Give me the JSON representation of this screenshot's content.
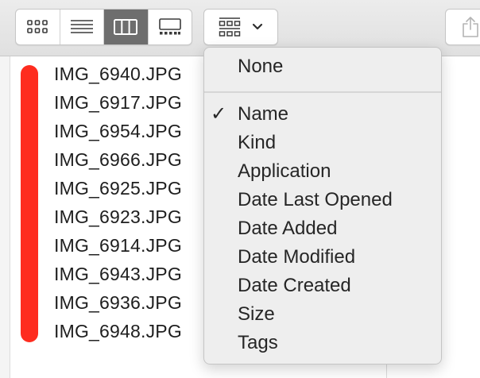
{
  "toolbar": {
    "view_buttons": [
      {
        "icon": "icon-view-icon",
        "active": false
      },
      {
        "icon": "list-view-icon",
        "active": false
      },
      {
        "icon": "column-view-icon",
        "active": true
      },
      {
        "icon": "gallery-view-icon",
        "active": false
      }
    ],
    "group_button": {
      "icon": "group-by-icon",
      "chevron": "chevron-down-icon"
    },
    "share_button": {
      "icon": "share-icon"
    }
  },
  "files": [
    "IMG_6940.JPG",
    "IMG_6917.JPG",
    "IMG_6954.JPG",
    "IMG_6966.JPG",
    "IMG_6925.JPG",
    "IMG_6923.JPG",
    "IMG_6914.JPG",
    "IMG_6943.JPG",
    "IMG_6936.JPG",
    "IMG_6948.JPG"
  ],
  "tag_color": "#fe2c1f",
  "group_menu": {
    "none_label": "None",
    "checkmark": "✓",
    "selected": "Name",
    "items": [
      "Name",
      "Kind",
      "Application",
      "Date Last Opened",
      "Date Added",
      "Date Modified",
      "Date Created",
      "Size",
      "Tags"
    ]
  }
}
